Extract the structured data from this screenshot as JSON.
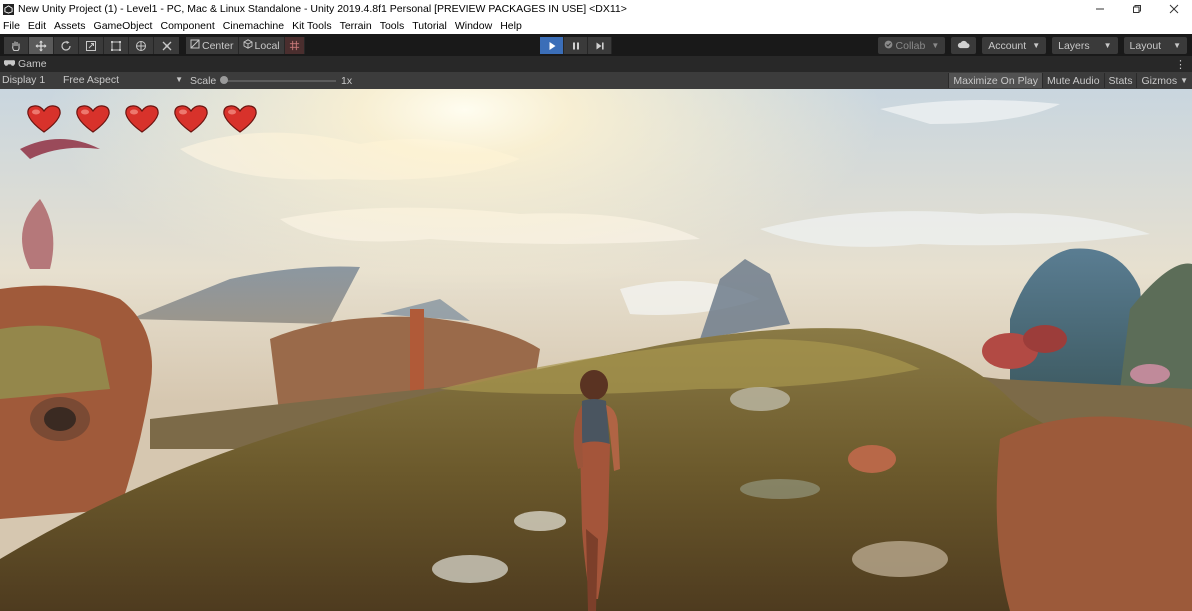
{
  "window": {
    "title": "New Unity Project (1) - Level1 - PC, Mac & Linux Standalone - Unity 2019.4.8f1 Personal [PREVIEW PACKAGES IN USE] <DX11>",
    "controls": [
      "minimize-icon",
      "restore-icon",
      "close-icon"
    ]
  },
  "menu": {
    "items": [
      "File",
      "Edit",
      "Assets",
      "GameObject",
      "Component",
      "Cinemachine",
      "Kit Tools",
      "Terrain",
      "Tools",
      "Tutorial",
      "Window",
      "Help"
    ]
  },
  "toolbar": {
    "transform_tools": [
      "hand-tool-icon",
      "move-tool-icon",
      "rotate-tool-icon",
      "scale-tool-icon",
      "rect-tool-icon",
      "transform-tool-icon",
      "custom-tool-icon"
    ],
    "active_tool": "move-tool-icon",
    "pivot_label": "Center",
    "rotation_label": "Local",
    "playback": [
      "play-icon",
      "pause-icon",
      "step-icon"
    ],
    "play_active": true,
    "play_color": "#3b6eb8",
    "collab_label": "Collab",
    "account_label": "Account",
    "layers_label": "Layers",
    "layout_label": "Layout"
  },
  "game_tab": {
    "label": "Game"
  },
  "game_controls": {
    "display": "Display 1",
    "aspect": "Free Aspect",
    "scale_label": "Scale",
    "scale_value": "1x",
    "maximize_on_play": "Maximize On Play",
    "mute_audio": "Mute Audio",
    "stats": "Stats",
    "gizmos": "Gizmos"
  },
  "game_view": {
    "hearts_count": 5,
    "heart_color": "#d8322b"
  }
}
